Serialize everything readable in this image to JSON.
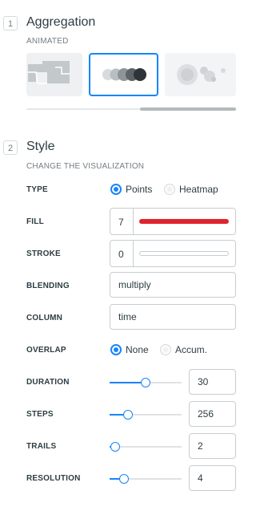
{
  "aggregation": {
    "step": "1",
    "title": "Aggregation",
    "subtitle": "ANIMATED",
    "options": [
      {
        "icon": "aggregation-grid-icon",
        "selected": false
      },
      {
        "icon": "aggregation-points-icon",
        "selected": true
      },
      {
        "icon": "aggregation-clusters-icon",
        "selected": false
      }
    ]
  },
  "style": {
    "step": "2",
    "title": "Style",
    "subtitle": "CHANGE THE VISUALIZATION",
    "type": {
      "label": "TYPE",
      "options": [
        "Points",
        "Heatmap"
      ],
      "selected": "Points"
    },
    "fill": {
      "label": "FILL",
      "value": "7",
      "color": "#e0232e"
    },
    "stroke": {
      "label": "STROKE",
      "value": "0"
    },
    "blending": {
      "label": "BLENDING",
      "value": "multiply"
    },
    "column": {
      "label": "COLUMN",
      "value": "time"
    },
    "overlap": {
      "label": "OVERLAP",
      "options": [
        "None",
        "Accum."
      ],
      "selected": "None"
    },
    "duration": {
      "label": "DURATION",
      "value": "30",
      "level": 0.5
    },
    "steps": {
      "label": "STEPS",
      "value": "256",
      "level": 0.26
    },
    "trails": {
      "label": "TRAILS",
      "value": "2",
      "level": 0.08
    },
    "resolution": {
      "label": "RESOLUTION",
      "value": "4",
      "level": 0.2
    }
  },
  "colors": {
    "accent": "#1785fb",
    "text": "#2e3c43",
    "muted": "#747d82"
  }
}
